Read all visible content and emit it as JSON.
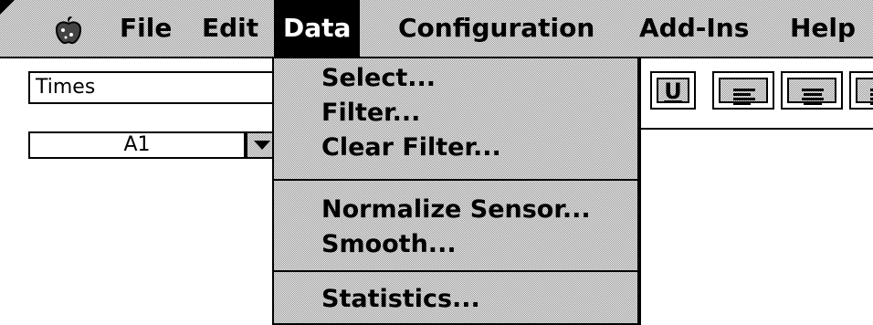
{
  "menubar": {
    "items": [
      {
        "label": "File"
      },
      {
        "label": "Edit"
      },
      {
        "label": "Data"
      },
      {
        "label": "Configuration"
      },
      {
        "label": "Add-Ins"
      },
      {
        "label": "Help"
      }
    ],
    "active_item": "Data",
    "apple_icon": "apple-logo-icon"
  },
  "toolbar": {
    "font_name": "Times",
    "underline_label": "U",
    "align_icons": [
      "align-left-icon",
      "align-center-icon",
      "align-right-icon"
    ]
  },
  "formula_bar": {
    "cell_reference": "A1",
    "dropdown_icon": "triangle-down-icon"
  },
  "data_menu": {
    "groups": [
      [
        {
          "label": "Select..."
        },
        {
          "label": "Filter..."
        },
        {
          "label": "Clear Filter..."
        }
      ],
      [
        {
          "label": "Normalize Sensor..."
        },
        {
          "label": "Smooth..."
        }
      ],
      [
        {
          "label": "Statistics..."
        }
      ]
    ]
  }
}
